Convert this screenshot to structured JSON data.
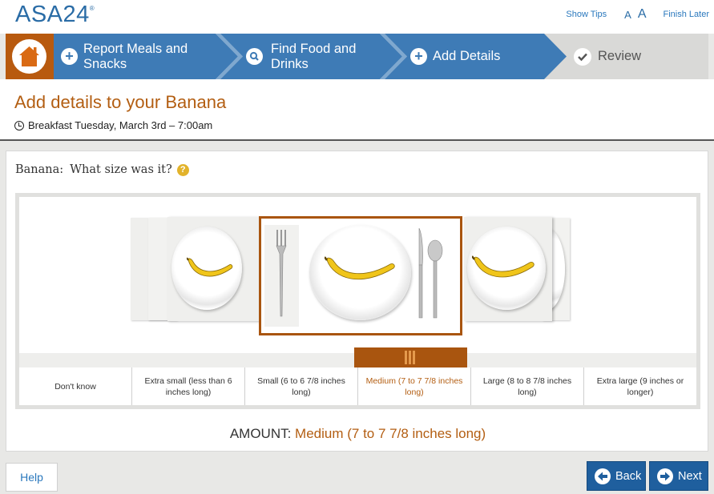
{
  "app": {
    "logo": "ASA24",
    "logo_mark": "®"
  },
  "top_links": {
    "show_tips": "Show Tips",
    "font_small": "A",
    "font_large": "A",
    "finish_later": "Finish Later"
  },
  "steps": [
    {
      "label_line1": "Report Meals and",
      "label_line2": "Snacks",
      "icon": "plus-icon"
    },
    {
      "label_line1": "Find Food and",
      "label_line2": "Drinks",
      "icon": "search-icon"
    },
    {
      "label_line1": "Add Details",
      "label_line2": "",
      "icon": "plus-icon"
    },
    {
      "label_line1": "Review",
      "label_line2": "",
      "icon": "check-icon"
    }
  ],
  "colors": {
    "brand_orange": "#b85a0f",
    "step_blue": "#3e7bb6",
    "nav_blue": "#1f5f9e",
    "accent_text": "#b35e12"
  },
  "header": {
    "title": "Add details to your Banana",
    "meal": "Breakfast Tuesday, March 3rd – 7:00am"
  },
  "question": {
    "food": "Banana:",
    "text": "What size was it?",
    "help": "?"
  },
  "size_options": [
    {
      "label": "Don't know",
      "selected": false
    },
    {
      "label": "Extra small (less than 6 inches long)",
      "selected": false
    },
    {
      "label": "Small (6 to 6 7/8 inches long)",
      "selected": false
    },
    {
      "label": "Medium (7 to 7 7/8 inches long)",
      "selected": true
    },
    {
      "label": "Large (8 to 8 7/8 inches long)",
      "selected": false
    },
    {
      "label": "Extra large (9 inches or longer)",
      "selected": false
    }
  ],
  "amount": {
    "label": "AMOUNT:",
    "value": "Medium (7 to 7 7/8 inches long)"
  },
  "footer": {
    "help": "Help",
    "back": "Back",
    "next": "Next"
  }
}
